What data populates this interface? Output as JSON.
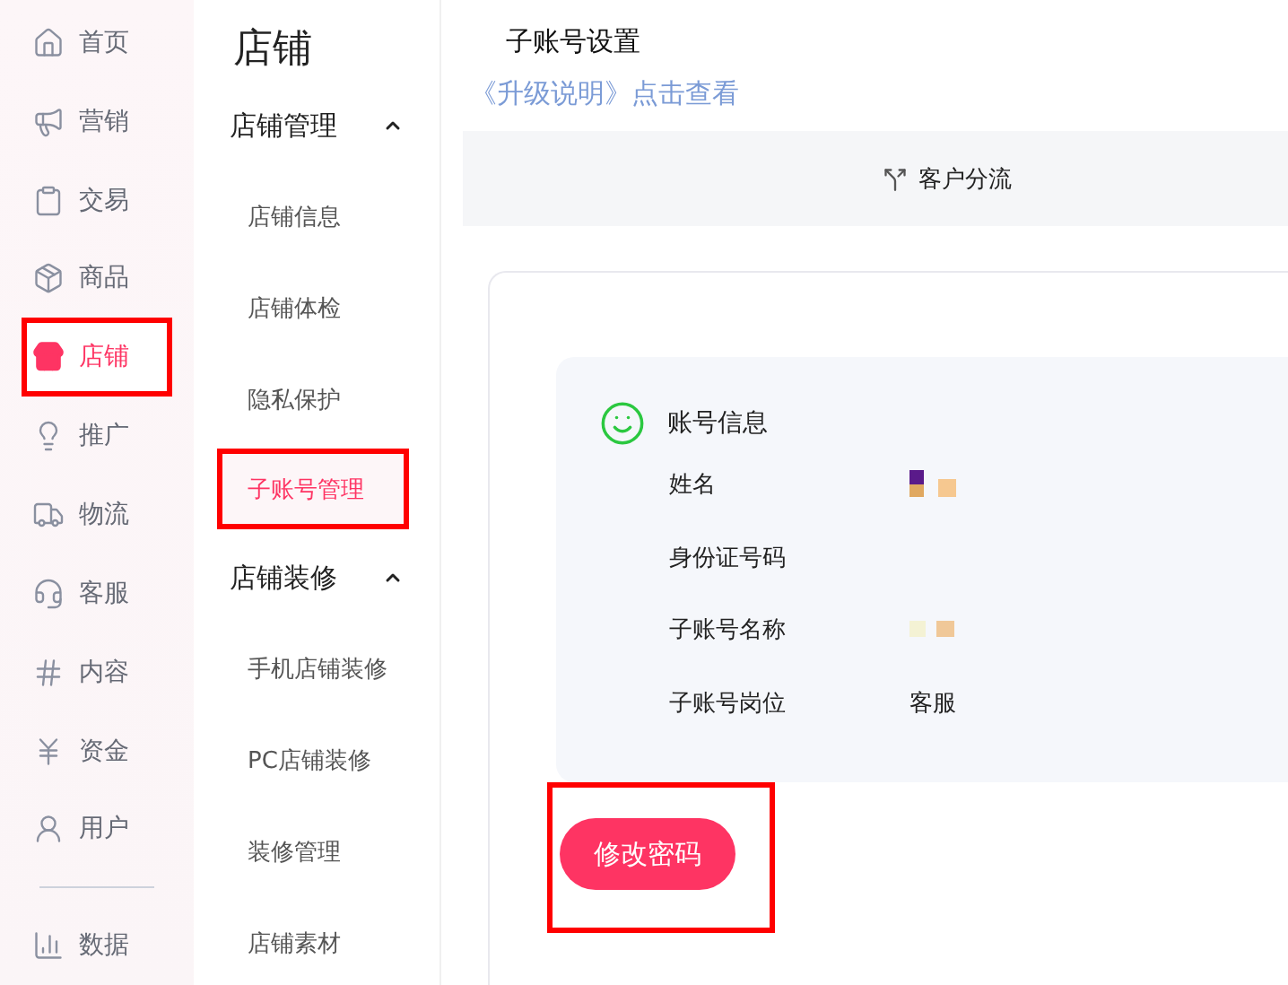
{
  "nav": {
    "items": [
      {
        "label": "首页",
        "selected": false,
        "highlighted": false
      },
      {
        "label": "营销",
        "selected": false,
        "highlighted": false
      },
      {
        "label": "交易",
        "selected": false,
        "highlighted": false
      },
      {
        "label": "商品",
        "selected": false,
        "highlighted": false
      },
      {
        "label": "店铺",
        "selected": true,
        "highlighted": true
      },
      {
        "label": "推广",
        "selected": false,
        "highlighted": false
      },
      {
        "label": "物流",
        "selected": false,
        "highlighted": false
      },
      {
        "label": "客服",
        "selected": false,
        "highlighted": false
      },
      {
        "label": "内容",
        "selected": false,
        "highlighted": false
      },
      {
        "label": "资金",
        "selected": false,
        "highlighted": false
      },
      {
        "label": "用户",
        "selected": false,
        "highlighted": false
      },
      {
        "label": "数据",
        "selected": false,
        "highlighted": false
      }
    ]
  },
  "submenu": {
    "title": "店铺",
    "groups": [
      {
        "label": "店铺管理",
        "expanded": true,
        "items": [
          {
            "label": "店铺信息",
            "selected": false,
            "highlighted": false
          },
          {
            "label": "店铺体检",
            "selected": false,
            "highlighted": false
          },
          {
            "label": "隐私保护",
            "selected": false,
            "highlighted": false
          },
          {
            "label": "子账号管理",
            "selected": true,
            "highlighted": true
          }
        ]
      },
      {
        "label": "店铺装修",
        "expanded": true,
        "items": [
          {
            "label": "手机店铺装修",
            "selected": false,
            "highlighted": false
          },
          {
            "label": "PC店铺装修",
            "selected": false,
            "highlighted": false
          },
          {
            "label": "装修管理",
            "selected": false,
            "highlighted": false
          },
          {
            "label": "店铺素材",
            "selected": false,
            "highlighted": false
          }
        ]
      }
    ]
  },
  "main": {
    "title": "子账号设置",
    "upgrade_link": "《升级说明》点击查看",
    "tab_bar": {
      "label": "客户分流"
    },
    "account_info": {
      "title": "账号信息",
      "rows": [
        {
          "label": "姓名",
          "redacted": true
        },
        {
          "label": "身份证号码",
          "redacted": false
        },
        {
          "label": "子账号名称",
          "redacted": true
        },
        {
          "label": "子账号岗位",
          "value": "客服",
          "redacted": false
        }
      ]
    },
    "button": {
      "label": "修改密码",
      "highlighted": true
    }
  }
}
